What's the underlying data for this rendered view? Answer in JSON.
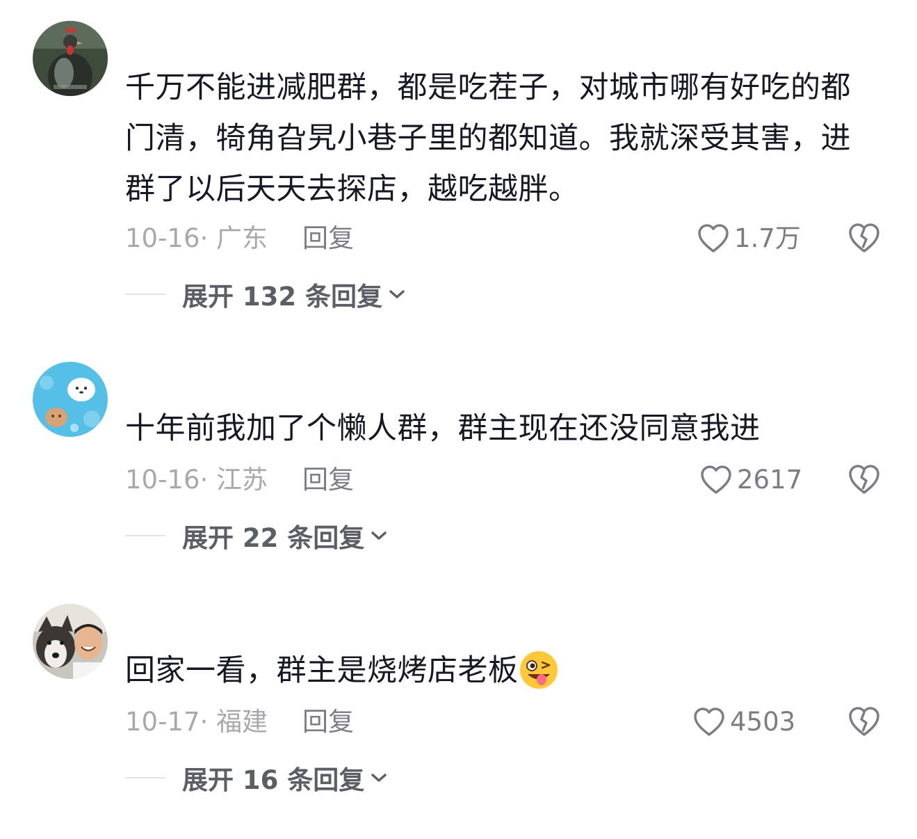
{
  "comments": [
    {
      "text": "千万不能进减肥群，都是吃茬子，对城市哪有好吃的都门清，犄角旮旯小巷子里的都知道。我就深受其害，进群了以后天天去探店，越吃越胖。",
      "date_location": "10-16· 广东",
      "reply_label": "回复",
      "likes": "1.7万",
      "expand_label": "展开 132 条回复",
      "avatar_icon": "rooster-avatar-icon"
    },
    {
      "text": "十年前我加了个懒人群，群主现在还没同意我进",
      "date_location": "10-16· 江苏",
      "reply_label": "回复",
      "likes": "2617",
      "expand_label": "展开 22 条回复",
      "avatar_icon": "cartoon-avatar-icon"
    },
    {
      "text": "回家一看，群主是烧烤店老板",
      "date_location": "10-17· 福建",
      "reply_label": "回复",
      "likes": "4503",
      "expand_label": "展开 16 条回复",
      "avatar_icon": "dog-and-person-avatar-icon",
      "emoji": "winking-tongue-emoji"
    }
  ],
  "colors": {
    "text": "#161823",
    "meta": "#a8a8ae",
    "action": "#7b7d84",
    "expand": "#5c5e66"
  }
}
